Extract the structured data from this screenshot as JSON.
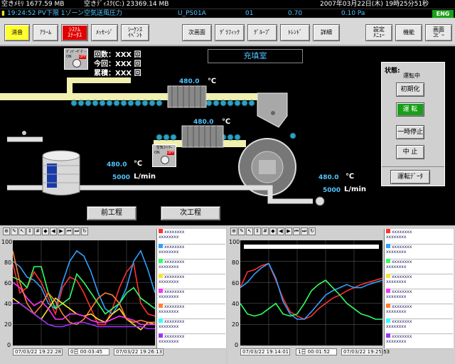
{
  "topbar": {
    "mem": "空きﾒﾓﾘ 1677.59 MB",
    "disk": "空きﾃﾞｨｽｸ(C:) 23369.14 MB",
    "datetime": "2007年03月22日(木) 19時25分51秒"
  },
  "alarm": {
    "text": "19:24:52 PV下限  1ゾーン空気送風圧力",
    "tag": "U_PS01A",
    "id": "01",
    "value": "0.70",
    "limit": "0.10 Pa"
  },
  "lang_button": "ENG",
  "toolbar": {
    "silence": "消音",
    "alarm": "ｱﾗｰﾑ",
    "system_status": "ｼｽﾃﾑ\nｽﾃｰﾀｽ",
    "message": "ﾒｯｾｰｼﾞ",
    "sequence_event": "ｼｰｹﾝｽ\nｲﾍﾞﾝﾄ",
    "next_screen": "次画面",
    "graphic": "ｸﾞﾗﾌｨｯｸ",
    "group": "ｸﾞﾙｰﾌﾟ",
    "trend": "ﾄﾚﾝﾄﾞ",
    "detail": "詳細",
    "settings_menu": "設定\nﾒﾆｭｰ",
    "function": "機能",
    "screen_copy": "画面\nｺﾋﾟｰ"
  },
  "process": {
    "title": "充填室",
    "damper1_label": "ﾀﾞﾝﾊﾟｰｻﾞﾀﾞｰ",
    "damper2_label": "空気ｽｲｯﾁｰ",
    "on": "ON",
    "off": "OFF",
    "counters": [
      {
        "label": "回数",
        "value": "XXX",
        "unit": "回"
      },
      {
        "label": "今回",
        "value": "XXX",
        "unit": "回"
      },
      {
        "label": "累積",
        "value": "XXX",
        "unit": "回"
      }
    ],
    "temp1": "480.0",
    "temp2": "480.0",
    "temp3": "480.0",
    "temp4": "480.0",
    "temp_unit": "℃",
    "flow1": "5000",
    "flow2": "5000",
    "flow_unit": "L/min",
    "prev_step": "前工程",
    "next_step": "次工程"
  },
  "status_panel": {
    "title": "状態:",
    "state": "運転中",
    "init": "初期化",
    "run": "運 転",
    "pause": "一時停止",
    "stop": "中 止",
    "run_data": "運転ﾃﾞｰﾀ"
  },
  "trend_left": {
    "y_labels": [
      "100",
      "80",
      "60",
      "40",
      "20",
      "0"
    ],
    "start_time": "07/03/22 19:22:28",
    "span": "0日 00:03:45",
    "end_time": "07/03/22 19:26:13",
    "legend": [
      {
        "name": "xxxxxxxx",
        "line2": "xxxxxxxx",
        "color": "#ff3030"
      },
      {
        "name": "xxxxxxxx",
        "line2": "xxxxxxxx",
        "color": "#30a0ff"
      },
      {
        "name": "xxxxxxxx",
        "line2": "xxxxxxxx",
        "color": "#30ff60"
      },
      {
        "name": "xxxxxxxx",
        "line2": "xxxxxxxx",
        "color": "#ffe030"
      },
      {
        "name": "xxxxxxxx",
        "line2": "xxxxxxxx",
        "color": "#ff30ff"
      },
      {
        "name": "xxxxxxxx",
        "line2": "xxxxxxxx",
        "color": "#ff8030"
      },
      {
        "name": "xxxxxxxx",
        "line2": "xxxxxxxx",
        "color": "#30ffff"
      },
      {
        "name": "xxxxxxxx",
        "line2": "xxxxxxxx",
        "color": "#a030ff"
      }
    ]
  },
  "trend_right": {
    "y_labels": [
      "100",
      "80",
      "60",
      "40",
      "20",
      "0"
    ],
    "start_time": "07/03/22 19:14:01",
    "span": "1日 00:01:52",
    "end_time": "07/03/22 19:25:53",
    "legend": [
      {
        "name": "xxxxxxxx",
        "line2": "xxxxxxxx",
        "color": "#ff3030"
      },
      {
        "name": "xxxxxxxx",
        "line2": "xxxxxxxx",
        "color": "#30a0ff"
      },
      {
        "name": "xxxxxxxx",
        "line2": "xxxxxxxx",
        "color": "#30ff60"
      },
      {
        "name": "xxxxxxxx",
        "line2": "xxxxxxxx",
        "color": "#ffe030"
      },
      {
        "name": "xxxxxxxx",
        "line2": "xxxxxxxx",
        "color": "#ff30ff"
      },
      {
        "name": "xxxxxxxx",
        "line2": "xxxxxxxx",
        "color": "#ff8030"
      },
      {
        "name": "xxxxxxxx",
        "line2": "xxxxxxxx",
        "color": "#30ffff"
      },
      {
        "name": "xxxxxxxx",
        "line2": "xxxxxxxx",
        "color": "#a030ff"
      }
    ]
  },
  "chart_data": [
    {
      "type": "line",
      "ylim": [
        0,
        100
      ],
      "x": [
        0,
        1,
        2,
        3,
        4,
        5,
        6,
        7,
        8,
        9,
        10,
        11,
        12,
        13,
        14,
        15,
        16,
        17,
        18,
        19,
        20
      ],
      "series": [
        {
          "color": "#ff3030",
          "values": [
            78,
            50,
            55,
            70,
            60,
            45,
            30,
            55,
            65,
            62,
            50,
            35,
            20,
            20,
            35,
            55,
            70,
            78,
            40,
            30,
            28
          ]
        },
        {
          "color": "#30a0ff",
          "values": [
            80,
            75,
            65,
            62,
            55,
            40,
            35,
            60,
            80,
            90,
            85,
            70,
            50,
            35,
            30,
            40,
            55,
            80,
            90,
            72,
            50
          ]
        },
        {
          "color": "#30ff60",
          "values": [
            65,
            62,
            55,
            75,
            75,
            50,
            35,
            40,
            45,
            68,
            60,
            50,
            40,
            30,
            35,
            40,
            50,
            55,
            45,
            40,
            35
          ]
        },
        {
          "color": "#ffe030",
          "values": [
            45,
            40,
            35,
            30,
            25,
            35,
            45,
            40,
            35,
            30,
            28,
            30,
            25,
            22,
            30,
            35,
            25,
            20,
            15,
            22,
            20
          ]
        },
        {
          "color": "#ff30ff",
          "values": [
            60,
            55,
            45,
            38,
            42,
            35,
            25,
            25,
            30,
            30,
            28,
            24,
            22,
            22,
            25,
            28,
            26,
            24,
            20,
            20,
            20
          ]
        },
        {
          "color": "#ff8030",
          "values": [
            90,
            60,
            40,
            30,
            38,
            50,
            42,
            30,
            22,
            20,
            25,
            35,
            45,
            50,
            48,
            40,
            25,
            22,
            24,
            22,
            22
          ]
        },
        {
          "color": "#a030ff",
          "values": [
            40,
            40,
            35,
            30,
            25,
            20,
            18,
            18,
            20,
            22,
            22,
            20,
            18,
            18,
            18,
            18,
            18,
            18,
            18,
            16,
            16
          ]
        }
      ]
    },
    {
      "type": "line",
      "ylim": [
        0,
        100
      ],
      "x": [
        0,
        1,
        2,
        3,
        4,
        5,
        6,
        7,
        8,
        9,
        10,
        11,
        12,
        13,
        14,
        15,
        16,
        17,
        18,
        19,
        20
      ],
      "series": [
        {
          "color": "#ff3030",
          "values": [
            55,
            70,
            72,
            76,
            78,
            62,
            45,
            32,
            28,
            25,
            28,
            35,
            40,
            45,
            48,
            52,
            55,
            58,
            60,
            62,
            64
          ]
        },
        {
          "color": "#30a0ff",
          "values": [
            55,
            60,
            68,
            74,
            78,
            64,
            42,
            30,
            25,
            25,
            32,
            40,
            48,
            52,
            55,
            58,
            55,
            55,
            58,
            60,
            62
          ]
        },
        {
          "color": "#30ff60",
          "values": [
            40,
            30,
            28,
            30,
            35,
            40,
            30,
            28,
            30,
            40,
            52,
            58,
            62,
            55,
            48,
            40,
            35,
            30,
            28,
            25,
            25
          ]
        }
      ]
    }
  ]
}
